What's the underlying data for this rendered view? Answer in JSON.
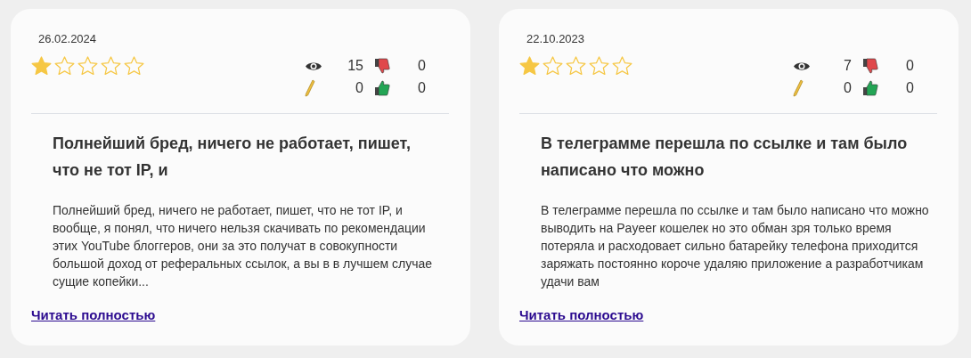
{
  "reviews": [
    {
      "date": "26.02.2024",
      "stars": 1,
      "views": "15",
      "comments": "0",
      "dislikes": "0",
      "likes": "0",
      "title": "Полнейший бред, ничего не работает, пишет, что не тот IP, и",
      "text": "Полнейший бред, ничего не работает, пишет, что не тот IP, и вообще, я понял, что ничего нельзя скачивать по рекомендации этих YouTube блоггеров, они за это получат в совокупности большой доход от реферальных ссылок, а вы в в лучшем случае сущие копейки...",
      "link": "Читать полностью"
    },
    {
      "date": "22.10.2023",
      "stars": 1,
      "views": "7",
      "comments": "0",
      "dislikes": "0",
      "likes": "0",
      "title": "В телеграмме перешла по ссылке и там было написано что можно",
      "text": "В телеграмме перешла по ссылке и там было написано что можно выводить на Payeer кошелек но это обман зря только время потеряла и расходовает сильно батарейку телефона приходится заряжать постоянно короче удаляю приложение а разработчикам удачи вам",
      "link": "Читать полностью"
    }
  ]
}
